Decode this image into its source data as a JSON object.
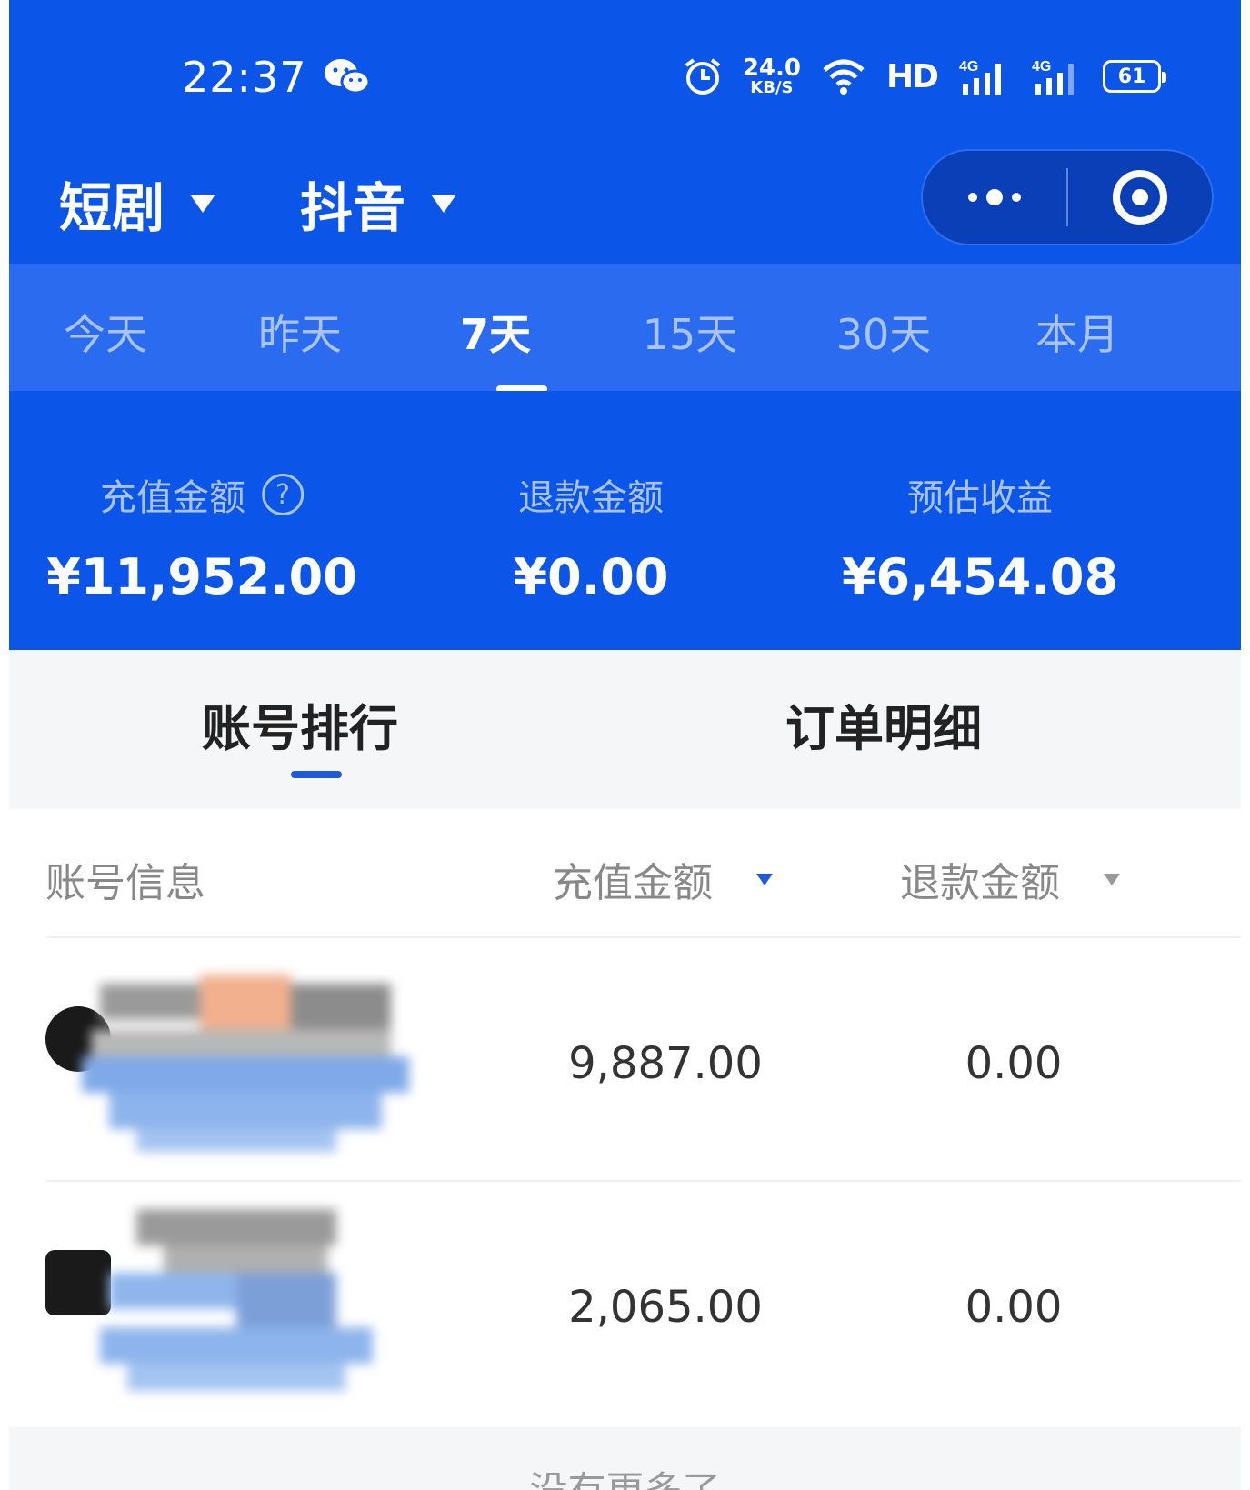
{
  "status_bar": {
    "time": "22:37",
    "network_speed_value": "24.0",
    "network_speed_unit": "KB/S",
    "hd_label": "HD",
    "battery": "61",
    "icons": [
      "wechat-icon",
      "alarm-icon",
      "wifi-icon",
      "signal-4g-icon",
      "signal-4g-icon",
      "battery-icon"
    ]
  },
  "header": {
    "category_select": "短剧",
    "platform_select": "抖音",
    "capsule_icons": [
      "more-icon",
      "target-icon"
    ]
  },
  "period_tabs": {
    "items": [
      "今天",
      "昨天",
      "7天",
      "15天",
      "30天",
      "本月"
    ],
    "active_index": 2
  },
  "summary": {
    "recharge_label": "充值金额",
    "recharge_value": "¥11,952.00",
    "refund_label": "退款金额",
    "refund_value": "¥0.00",
    "income_label": "预估收益",
    "income_value": "¥6,454.08",
    "help_icon": "?"
  },
  "section_tabs": {
    "items": [
      "账号排行",
      "订单明细"
    ],
    "active_index": 0
  },
  "table": {
    "headers": [
      "账号信息",
      "充值金额",
      "退款金额"
    ],
    "rows": [
      {
        "recharge": "9,887.00",
        "refund": "0.00"
      },
      {
        "recharge": "2,065.00",
        "refund": "0.00"
      }
    ]
  },
  "footer": {
    "text": "没有更多了"
  },
  "colors": {
    "brand_blue": "#0b55e8",
    "tab_bar_blue": "#2b6bf0",
    "muted_label": "#a9c3f7",
    "indicator_blue": "#1f5ad8"
  }
}
